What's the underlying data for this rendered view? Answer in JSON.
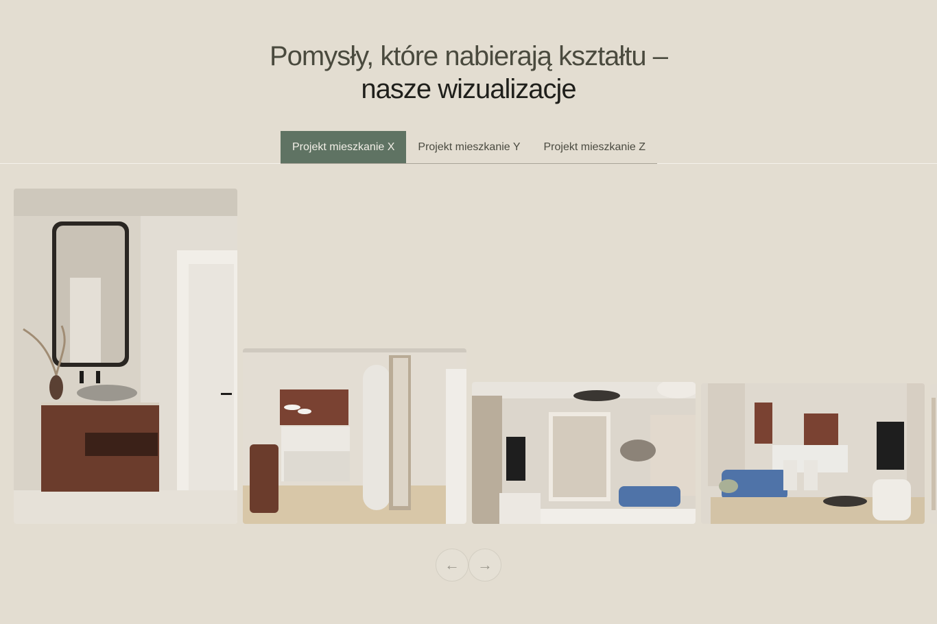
{
  "section": {
    "heading_line1": "Pomysły, które nabierają kształtu –",
    "heading_line2": "nasze wizualizacje"
  },
  "tabs": [
    {
      "label": "Projekt mieszkanie X",
      "active": true
    },
    {
      "label": "Projekt mieszkanie Y",
      "active": false
    },
    {
      "label": "Projekt mieszkanie Z",
      "active": false
    }
  ],
  "gallery": {
    "images": [
      {
        "subject": "bathroom-vanity-render"
      },
      {
        "subject": "kitchen-hallway-render"
      },
      {
        "subject": "living-room-render"
      },
      {
        "subject": "living-kitchen-render"
      }
    ]
  },
  "navigation": {
    "prev_icon": "arrow-left-icon",
    "next_icon": "arrow-right-icon",
    "prev_glyph": "←",
    "next_glyph": "→"
  },
  "colors": {
    "background": "#e3ddd1",
    "active_tab": "#5f7363",
    "wood": "#6b3c2c"
  }
}
